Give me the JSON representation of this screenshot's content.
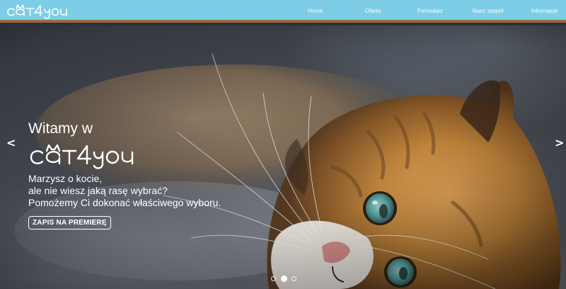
{
  "brand": {
    "name": "CAT4YOU",
    "logo_text": "cat4you"
  },
  "nav": {
    "items": [
      {
        "label": "Home"
      },
      {
        "label": "Oferta"
      },
      {
        "label": "Formularz"
      },
      {
        "label": "Nasz zespół"
      },
      {
        "label": "Informacje"
      }
    ]
  },
  "hero": {
    "welcome": "Witamy w",
    "logo_text": "cat4you",
    "tagline": [
      "Marzysz o kocie,",
      "ale nie wiesz jaką rasę wybrać?",
      "Pomożemy Ci dokonać właściwego wyboru."
    ],
    "cta_label": "ZAPIS NA PREMIERĘ",
    "prev_label": "<",
    "next_label": ">",
    "slide_count": 3,
    "active_slide": 2
  },
  "colors": {
    "navbar": "#7ccde5",
    "navbar_border": "#9a6b43",
    "text": "#ffffff",
    "cat_fur": "#c98a3c",
    "cat_eye": "#5da9a6"
  }
}
